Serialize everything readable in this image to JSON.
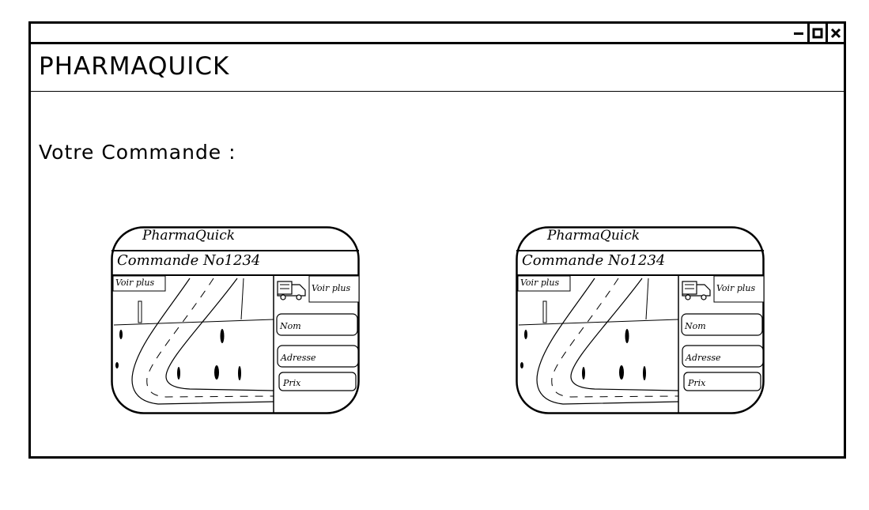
{
  "window": {
    "controls": [
      "minimize-icon",
      "maximize-icon",
      "close-icon"
    ]
  },
  "header": {
    "title": "PHARMAQUICK"
  },
  "main": {
    "section_title": "Votre Commande :",
    "orders": [
      {
        "brand": "PharmaQuick",
        "order_label": "Commande No1234",
        "map_link": "Voir plus",
        "delivery_link": "Voir plus",
        "delivery_icon": "truck-icon",
        "fields": {
          "name": "Nom",
          "address": "Adresse",
          "price": "Prix"
        }
      },
      {
        "brand": "PharmaQuick",
        "order_label": "Commande No1234",
        "map_link": "Voir plus",
        "delivery_link": "Voir plus",
        "delivery_icon": "truck-icon",
        "fields": {
          "name": "Nom",
          "address": "Adresse",
          "price": "Prix"
        }
      }
    ]
  }
}
